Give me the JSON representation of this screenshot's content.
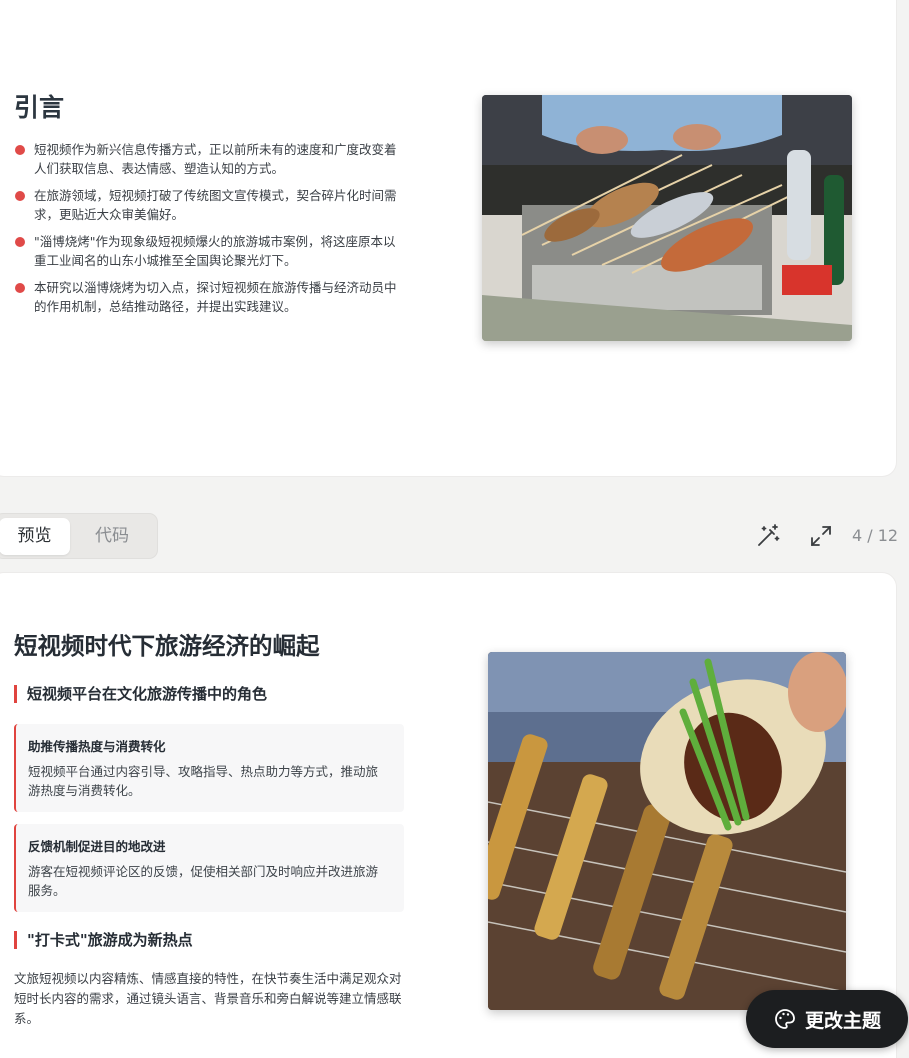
{
  "slide1": {
    "title": "引言",
    "bullets": [
      "短视频作为新兴信息传播方式，正以前所未有的速度和广度改变着人们获取信息、表达情感、塑造认知的方式。",
      "在旅游领域，短视频打破了传统图文宣传模式，契合碎片化时间需求，更贴近大众审美偏好。",
      "\"淄博烧烤\"作为现象级短视频爆火的旅游城市案例，将这座原本以重工业闻名的山东小城推至全国舆论聚光灯下。",
      "本研究以淄博烧烤为切入点，探讨短视频在旅游传播与经济动员中的作用机制，总结推动路径，并提出实践建议。"
    ]
  },
  "toolbar": {
    "tab_preview": "预览",
    "tab_code": "代码",
    "page_counter": "4 / 12",
    "icons": [
      "magic-wand-icon",
      "expand-icon"
    ]
  },
  "slide2": {
    "title": "短视频时代下旅游经济的崛起",
    "section1_heading": "短视频平台在文化旅游传播中的角色",
    "box1_title": "助推传播热度与消费转化",
    "box1_text": "短视频平台通过内容引导、攻略指导、热点助力等方式，推动旅游热度与消费转化。",
    "box2_title": "反馈机制促进目的地改进",
    "box2_text": "游客在短视频评论区的反馈，促使相关部门及时响应并改进旅游服务。",
    "section2_heading": "\"打卡式\"旅游成为新热点",
    "paragraph": "文旅短视频以内容精炼、情感直接的特性，在快节奏生活中满足观众对短时长内容的需求，通过镜头语言、背景音乐和旁白解说等建立情感联系。"
  },
  "theme_button": {
    "label": "更改主题",
    "icon": "palette-icon"
  },
  "colors": {
    "accent": "#e0443f",
    "bullet": "#e04a48",
    "button_bg": "#1c1e20"
  }
}
